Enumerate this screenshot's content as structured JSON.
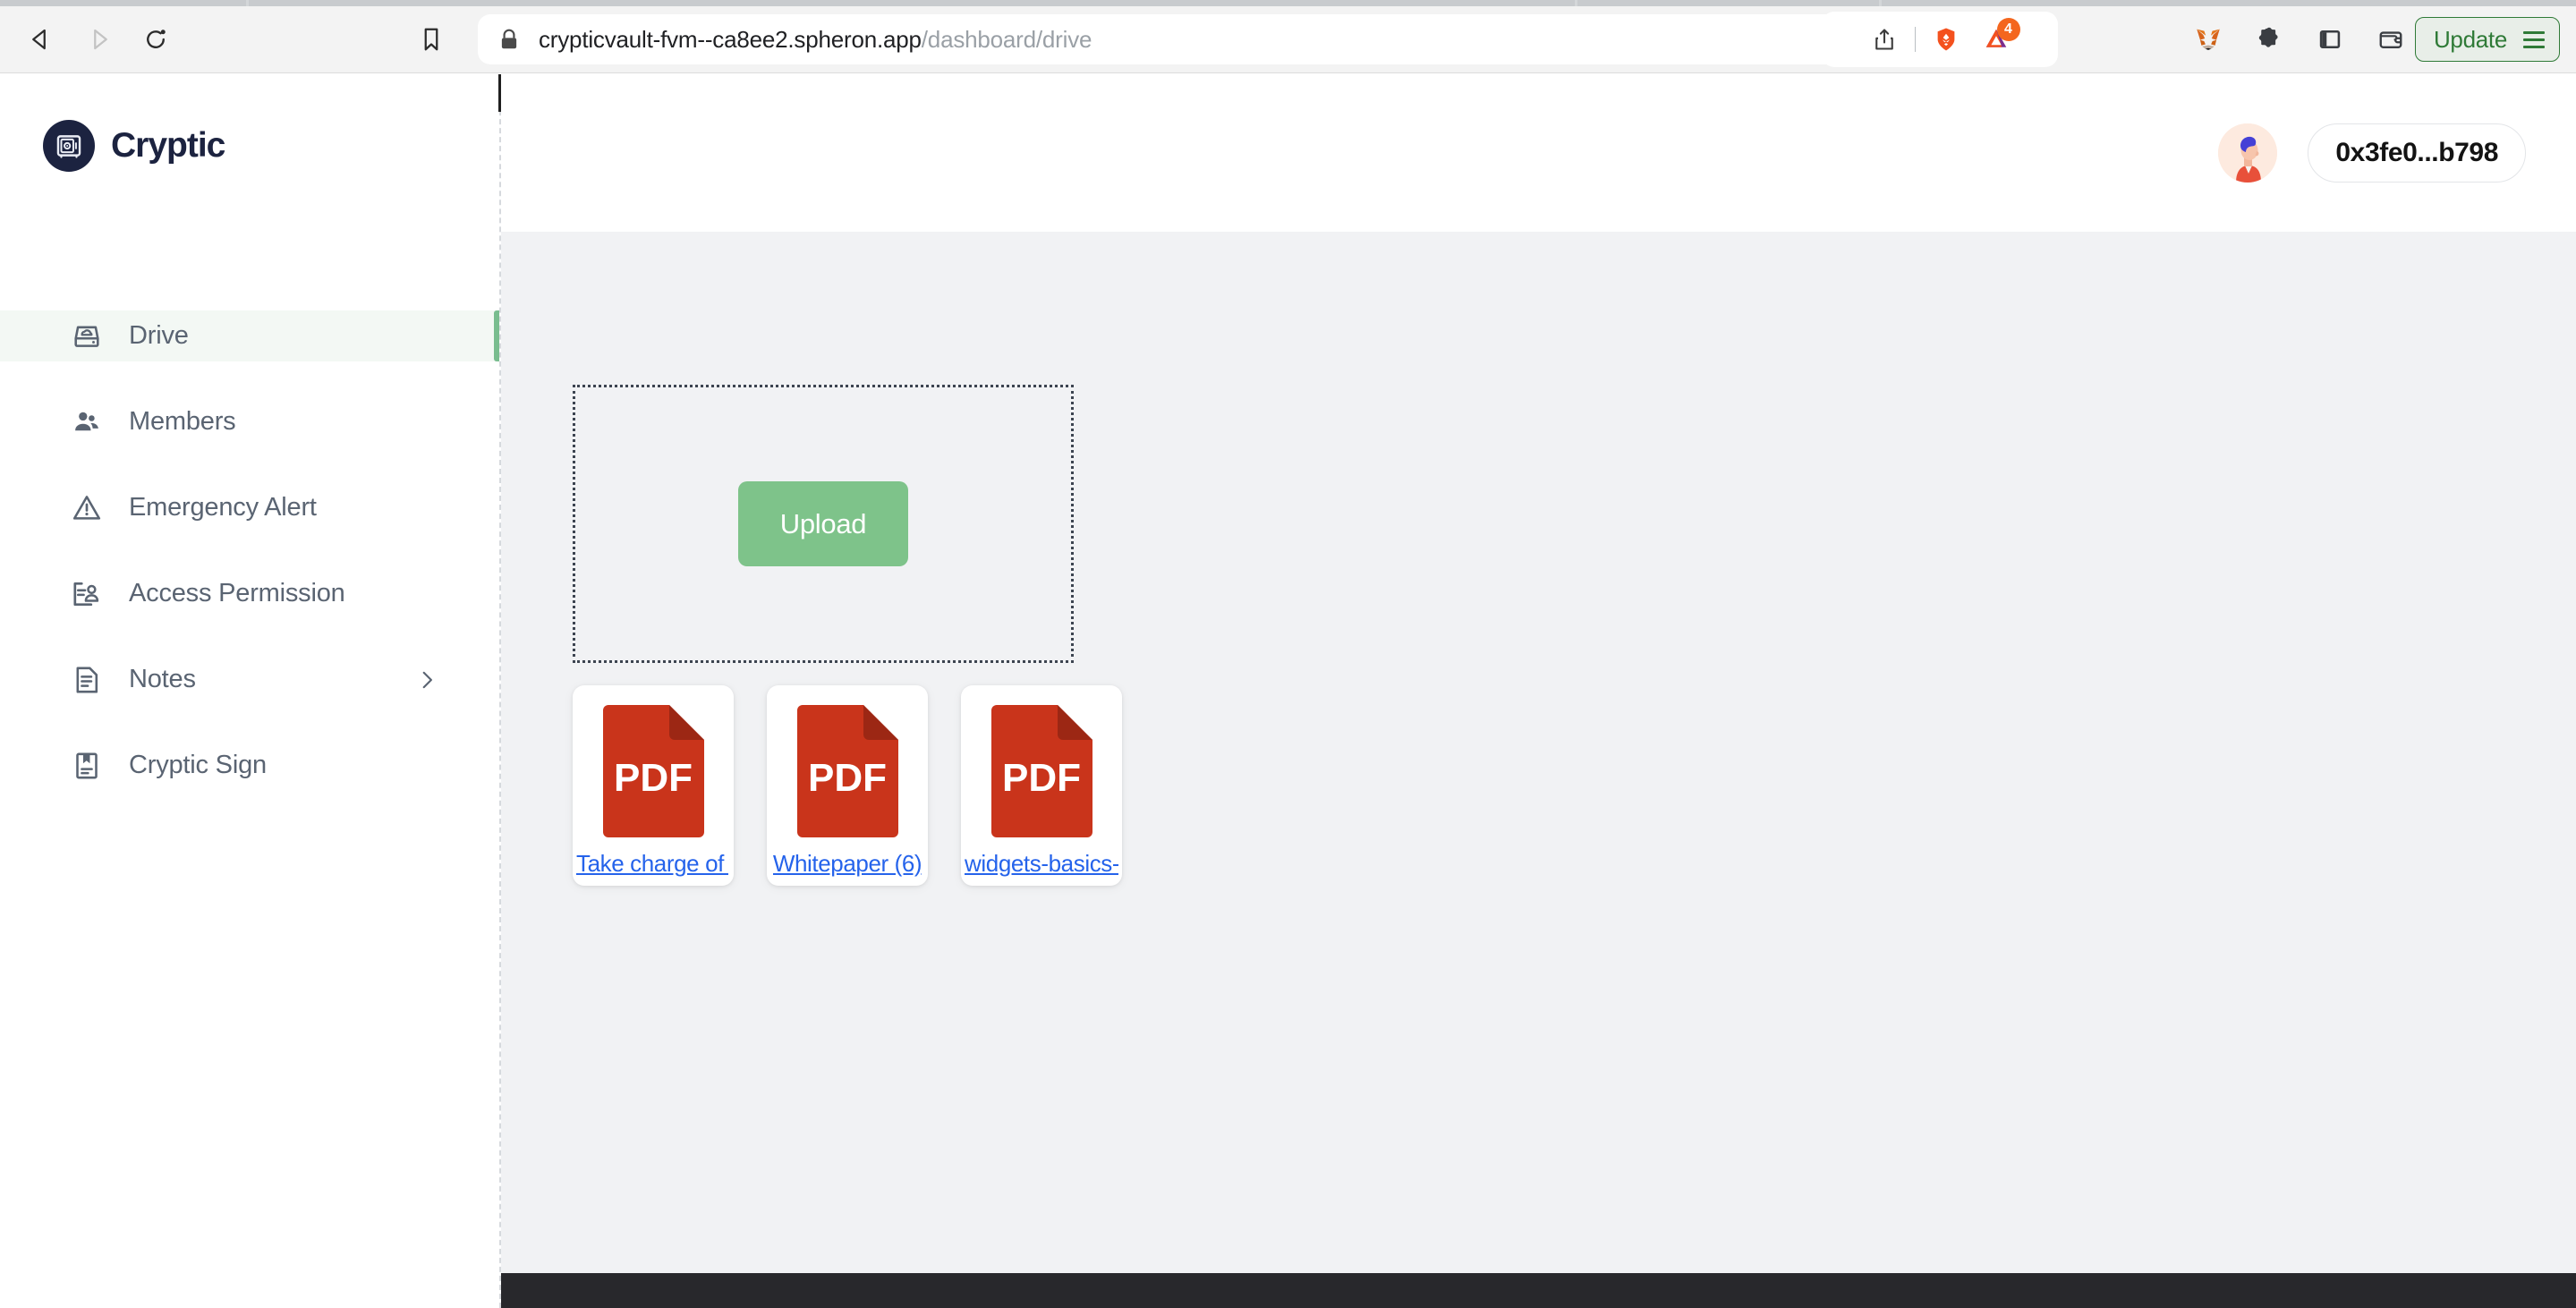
{
  "browser": {
    "back_icon": "back-arrow-icon",
    "forward_icon": "forward-arrow-icon",
    "reload_icon": "reload-icon",
    "bookmark_icon": "bookmark-icon",
    "lock_icon": "lock-icon",
    "url_host": "crypticvault-fvm--ca8ee2.spheron.app",
    "url_path": "/dashboard/drive",
    "url_full": "crypticvault-fvm--ca8ee2.spheron.app/dashboard/drive",
    "share_icon": "share-icon",
    "shields_icon": "brave-shields-lion-icon",
    "rewards_icon": "brave-rewards-triangle-icon",
    "rewards_badge_count": "4",
    "metamask_icon": "metamask-fox-icon",
    "extensions_icon": "puzzle-piece-icon",
    "sidebar_toggle_icon": "sidebar-panel-icon",
    "wallet_icon": "wallet-icon",
    "update_label": "Update",
    "menu_icon": "hamburger-menu-icon"
  },
  "sidebar": {
    "logo_icon": "vault-safe-icon",
    "logo_text": "Cryptic",
    "items": [
      {
        "label": "Drive",
        "icon": "cloud-drive-icon",
        "active": true,
        "chevron": false
      },
      {
        "label": "Members",
        "icon": "people-icon",
        "active": false,
        "chevron": false
      },
      {
        "label": "Emergency Alert",
        "icon": "warning-triangle-icon",
        "active": false,
        "chevron": false
      },
      {
        "label": "Access Permission",
        "icon": "id-card-person-icon",
        "active": false,
        "chevron": false
      },
      {
        "label": "Notes",
        "icon": "document-lines-icon",
        "active": false,
        "chevron": true
      },
      {
        "label": "Cryptic Sign",
        "icon": "document-bookmark-icon",
        "active": false,
        "chevron": false
      }
    ]
  },
  "topbar": {
    "avatar_icon": "user-avatar-illustration",
    "wallet_address": "0x3fe0...b798"
  },
  "drive": {
    "upload_label": "Upload",
    "files": [
      {
        "name": "Take charge of yo...",
        "type": "PDF",
        "icon": "pdf-file-icon"
      },
      {
        "name": "Whitepaper (6)",
        "type": "PDF",
        "icon": "pdf-file-icon"
      },
      {
        "name": "widgets-basics-c...",
        "type": "PDF",
        "icon": "pdf-file-icon"
      }
    ]
  },
  "colors": {
    "brand_navy": "#1c2340",
    "accent_green": "#7ec38a",
    "active_nav_bg": "#f3f8f4",
    "content_bg": "#f1f2f4",
    "pdf_red": "#c9341b",
    "link_blue": "#2563eb",
    "footer_dark": "#28282c",
    "update_green": "#2f7a37"
  }
}
